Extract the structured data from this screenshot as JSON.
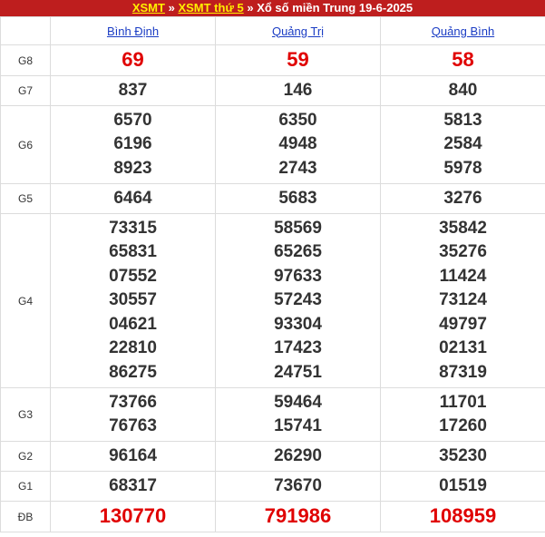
{
  "header": {
    "link1": "XSMT",
    "sep1": "»",
    "link2": "XSMT thứ 5",
    "sep2": "»",
    "title": "Xổ số miền Trung 19-6-2025"
  },
  "provinces": [
    "Bình Định",
    "Quảng Trị",
    "Quảng Bình"
  ],
  "prizes": [
    {
      "label": "G8",
      "values": [
        [
          "69"
        ],
        [
          "59"
        ],
        [
          "58"
        ]
      ]
    },
    {
      "label": "G7",
      "values": [
        [
          "837"
        ],
        [
          "146"
        ],
        [
          "840"
        ]
      ]
    },
    {
      "label": "G6",
      "values": [
        [
          "6570",
          "6196",
          "8923"
        ],
        [
          "6350",
          "4948",
          "2743"
        ],
        [
          "5813",
          "2584",
          "5978"
        ]
      ]
    },
    {
      "label": "G5",
      "values": [
        [
          "6464"
        ],
        [
          "5683"
        ],
        [
          "3276"
        ]
      ]
    },
    {
      "label": "G4",
      "values": [
        [
          "73315",
          "65831",
          "07552",
          "30557",
          "04621",
          "22810",
          "86275"
        ],
        [
          "58569",
          "65265",
          "97633",
          "57243",
          "93304",
          "17423",
          "24751"
        ],
        [
          "35842",
          "35276",
          "11424",
          "73124",
          "49797",
          "02131",
          "87319"
        ]
      ]
    },
    {
      "label": "G3",
      "values": [
        [
          "73766",
          "76763"
        ],
        [
          "59464",
          "15741"
        ],
        [
          "11701",
          "17260"
        ]
      ]
    },
    {
      "label": "G2",
      "values": [
        [
          "96164"
        ],
        [
          "26290"
        ],
        [
          "35230"
        ]
      ]
    },
    {
      "label": "G1",
      "values": [
        [
          "68317"
        ],
        [
          "73670"
        ],
        [
          "01519"
        ]
      ]
    },
    {
      "label": "ĐB",
      "values": [
        [
          "130770"
        ],
        [
          "791986"
        ],
        [
          "108959"
        ]
      ]
    }
  ],
  "colors": {
    "title_bg": "#be1e1e",
    "title_link": "#ffef00",
    "prize_red": "#e00000",
    "province_link": "#1a3cc4"
  }
}
